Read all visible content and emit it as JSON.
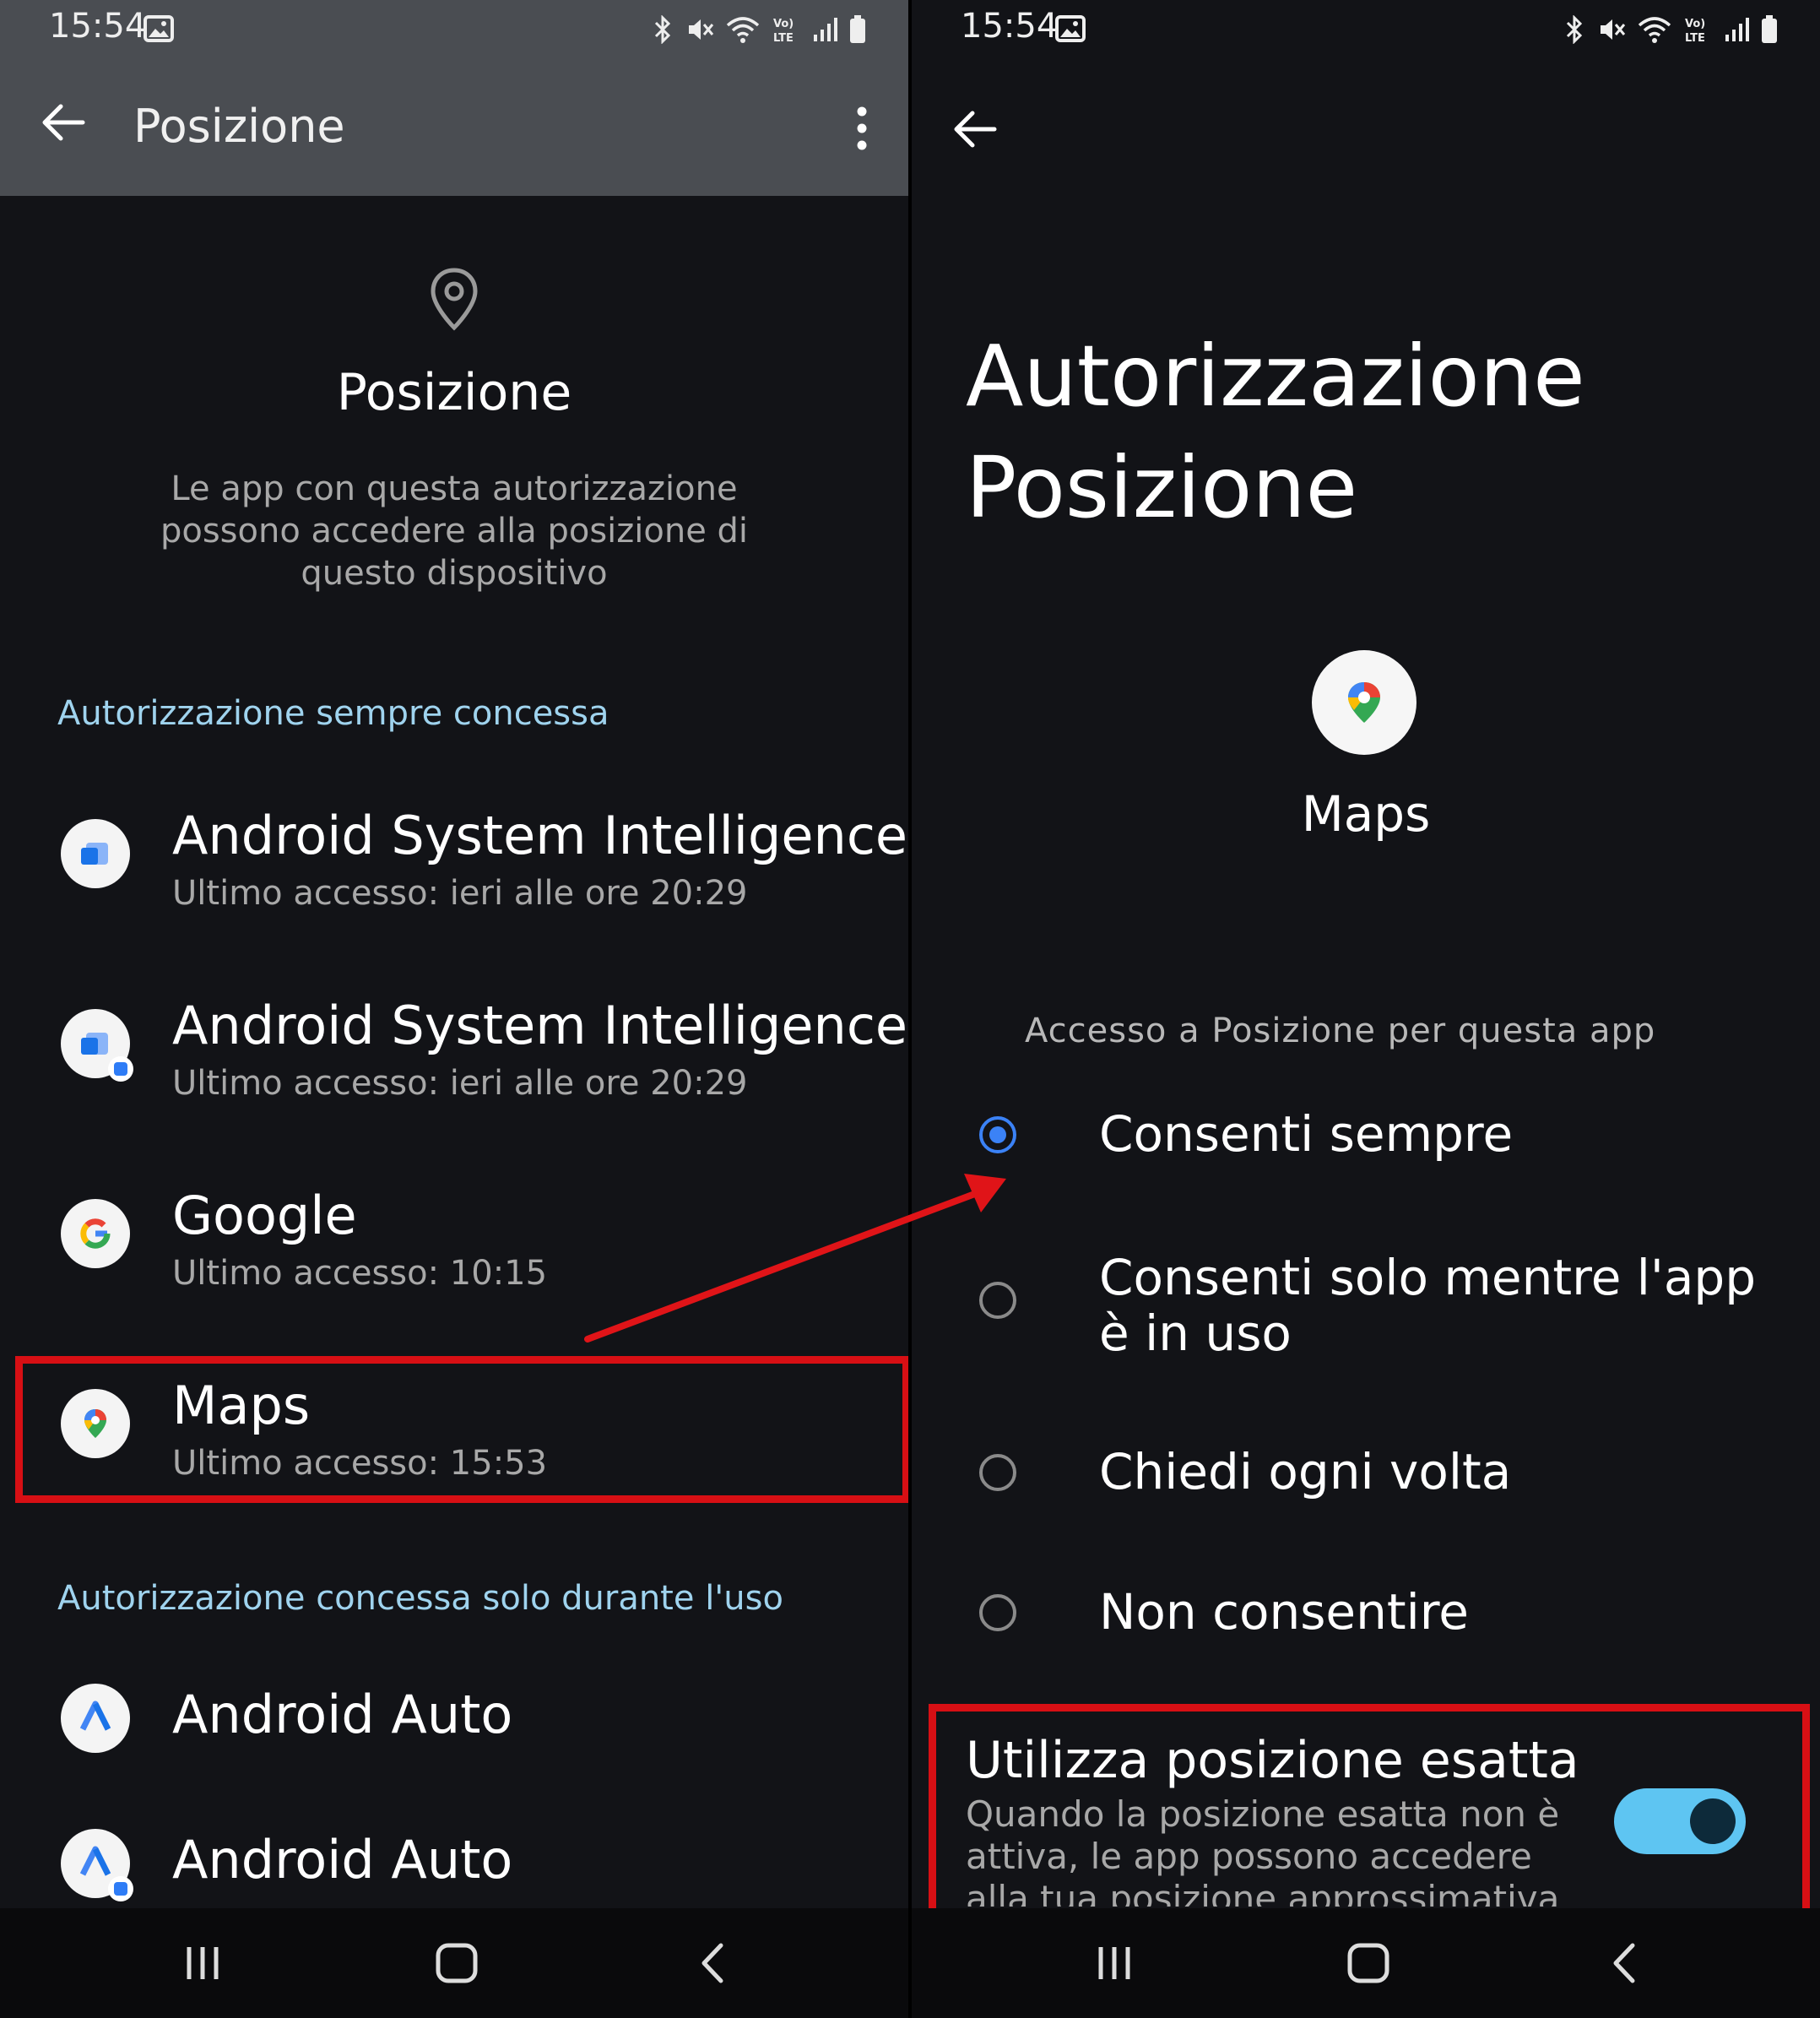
{
  "left_screen": {
    "status_bar": {
      "time": "15:54"
    },
    "app_bar": {
      "title": "Posizione"
    },
    "hero": {
      "title": "Posizione",
      "description": "Le app con questa autorizzazione possono accedere alla posizione di questo dispositivo"
    },
    "sections": [
      {
        "header": "Autorizzazione sempre concessa",
        "apps": [
          {
            "name": "Android System Intelligence",
            "last_access": "Ultimo accesso: ieri alle ore 20:29",
            "icon": "asi-icon"
          },
          {
            "name": "Android System Intelligence",
            "last_access": "Ultimo accesso: ieri alle ore 20:29",
            "icon": "asi-work-icon"
          },
          {
            "name": "Google",
            "last_access": "Ultimo accesso: 10:15",
            "icon": "google-icon"
          },
          {
            "name": "Maps",
            "last_access": "Ultimo accesso: 15:53",
            "icon": "maps-icon"
          }
        ]
      },
      {
        "header": "Autorizzazione concessa solo durante l'uso",
        "apps": [
          {
            "name": "Android Auto",
            "icon": "android-auto-icon"
          },
          {
            "name": "Android Auto",
            "icon": "android-auto-work-icon"
          }
        ]
      }
    ]
  },
  "right_screen": {
    "status_bar": {
      "time": "15:54"
    },
    "title": "Autorizzazione Posizione",
    "app_name": "Maps",
    "access_header": "Accesso a Posizione per questa app",
    "options": [
      {
        "label": "Consenti sempre",
        "selected": true
      },
      {
        "label": "Consenti solo mentre l'app è in uso",
        "selected": false
      },
      {
        "label": "Chiedi ogni volta",
        "selected": false
      },
      {
        "label": "Non consentire",
        "selected": false
      }
    ],
    "exact_location": {
      "title": "Utilizza posizione esatta",
      "description": "Quando la posizione esatta non è attiva, le app possono accedere alla tua posizione approssimativa",
      "enabled": true
    }
  },
  "colors": {
    "highlight_red": "#d70f14",
    "section_header": "#9fd3ee",
    "radio_selected": "#3b82f6",
    "toggle_on": "#5ec5f2"
  }
}
